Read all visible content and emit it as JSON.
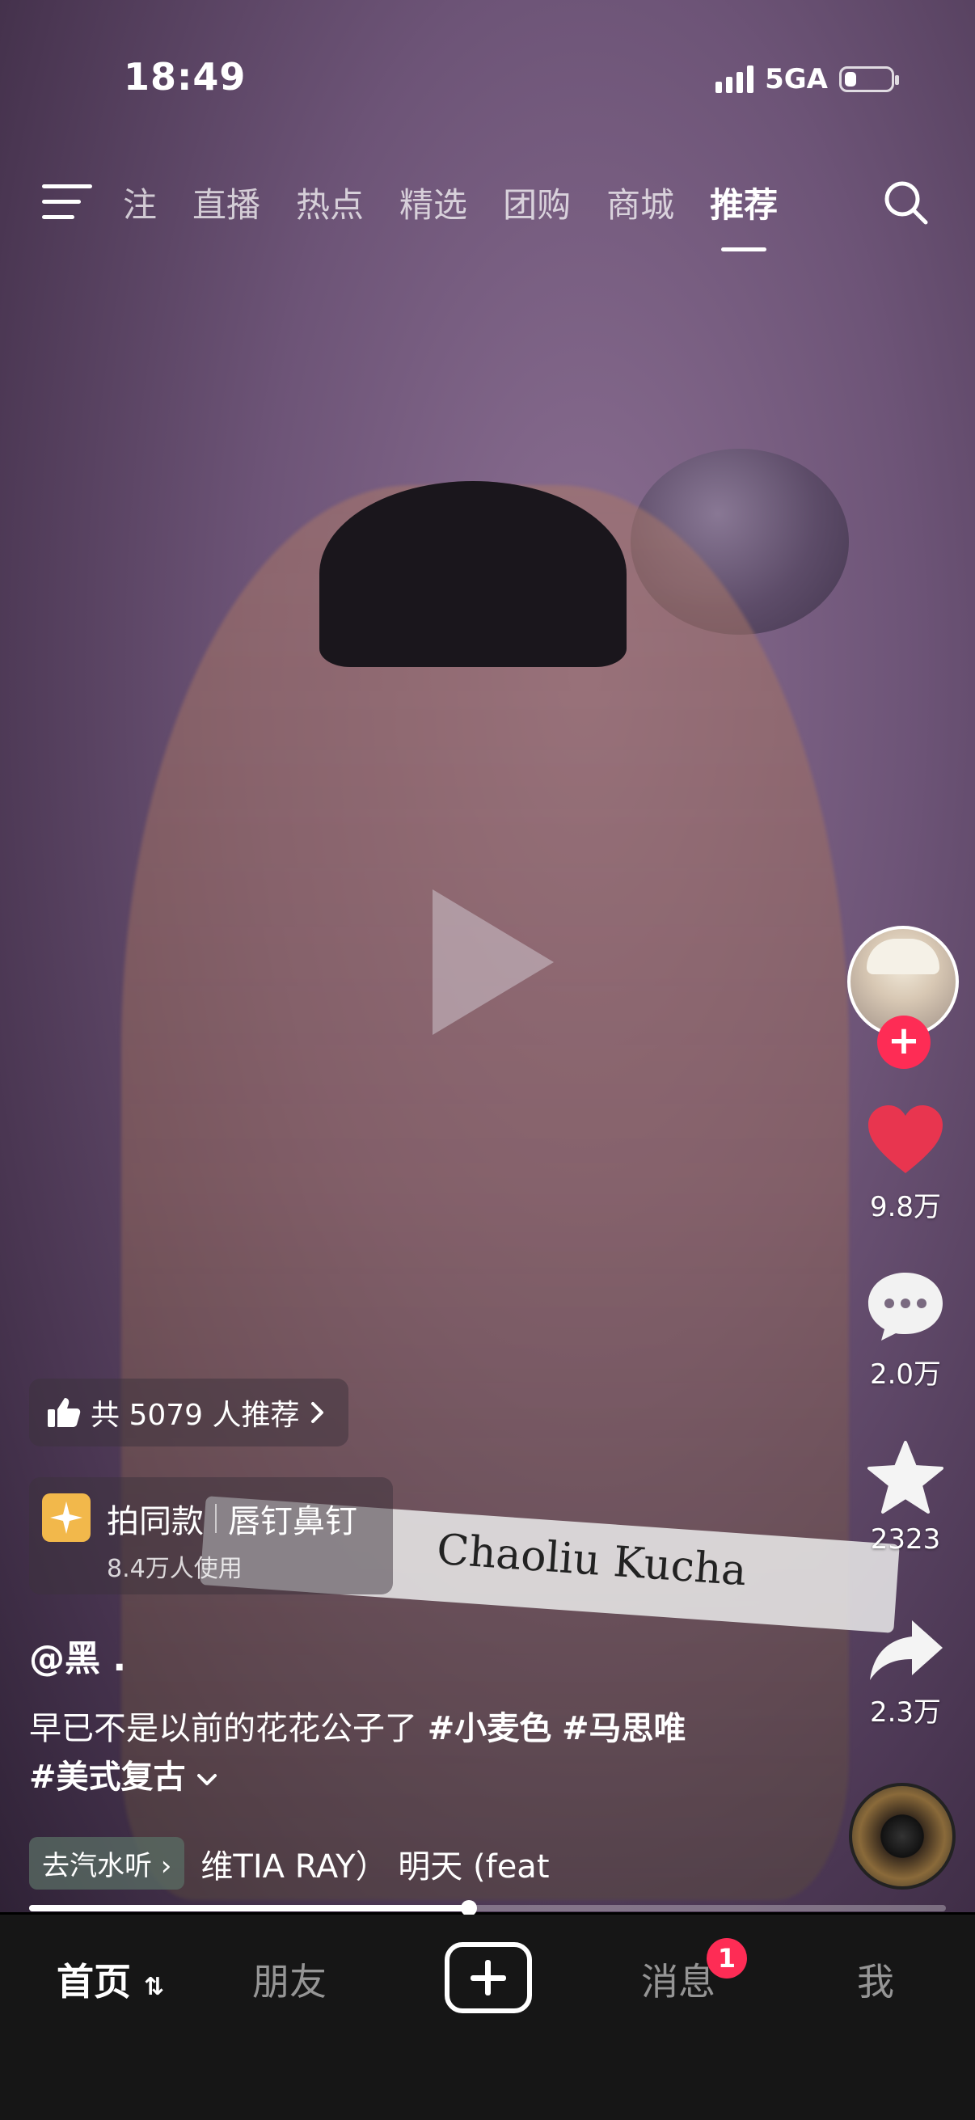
{
  "status_bar": {
    "time": "18:49",
    "network": "5GA",
    "battery_level": 0.35
  },
  "top_nav": {
    "tabs": [
      "注",
      "直播",
      "热点",
      "精选",
      "团购",
      "商城",
      "推荐"
    ],
    "active_tab": "推荐"
  },
  "video": {
    "band_text": "Chaoliu Kucha",
    "playback_progress": 0.48
  },
  "rail": {
    "likes": "9.8万",
    "comments": "2.0万",
    "favorites": "2323",
    "shares": "2.3万",
    "follow_symbol": "+"
  },
  "recommend": {
    "text": "共 5079 人推荐"
  },
  "same_style": {
    "label": "拍同款",
    "effect": "唇钉鼻钉",
    "usage": "8.4万人使用"
  },
  "post": {
    "username": "@黑 .",
    "caption_text": "早已不是以前的花花公子了 ",
    "tags": [
      "#小麦色",
      "#马思唯",
      "#美式复古"
    ]
  },
  "music": {
    "tag_label": "去汽水听",
    "title": "维TIA RAY）  明天 (feat"
  },
  "bottom_nav": {
    "home": "首页",
    "friends": "朋友",
    "messages": "消息",
    "me": "我",
    "message_badge": "1"
  },
  "colors": {
    "accent": "#fe2c55",
    "bottom_bar": "#161616"
  }
}
